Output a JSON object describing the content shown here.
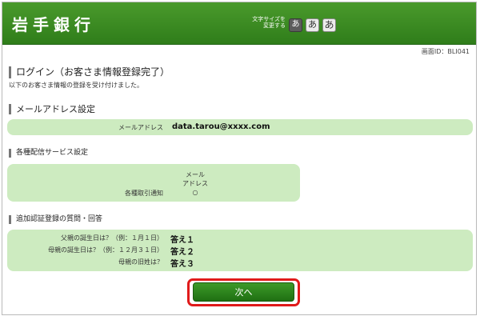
{
  "header": {
    "logo": "岩手銀行",
    "font_size_label_line1": "文字サイズを",
    "font_size_label_line2": "変更する",
    "font_sizes": [
      "あ",
      "あ",
      "あ"
    ]
  },
  "screen_id": "画面ID：BLI041",
  "page": {
    "title": "ログイン（お客さま情報登録完了）",
    "description": "以下のお客さま情報の登録を受け付けました。"
  },
  "email_section": {
    "title": "メールアドレス設定",
    "label": "メールアドレス",
    "value": "data.tarou@xxxx.com"
  },
  "delivery_section": {
    "title": "各種配信サービス設定",
    "column_header_line1": "メール",
    "column_header_line2": "アドレス",
    "row_label": "各種取引通知",
    "row_value": "○"
  },
  "auth_section": {
    "title": "追加認証登録の質問・回答",
    "items": [
      {
        "question": "父親の誕生日は？（例：１月１日）",
        "answer": "答え１"
      },
      {
        "question": "母親の誕生日は？（例：１２月３１日）",
        "answer": "答え２"
      },
      {
        "question": "母親の旧姓は？",
        "answer": "答え３"
      }
    ]
  },
  "next_button": "次へ",
  "colors": {
    "header_green": "#2f7d1a",
    "panel_green": "#cdebc0",
    "highlight_red": "#e01a1a"
  }
}
